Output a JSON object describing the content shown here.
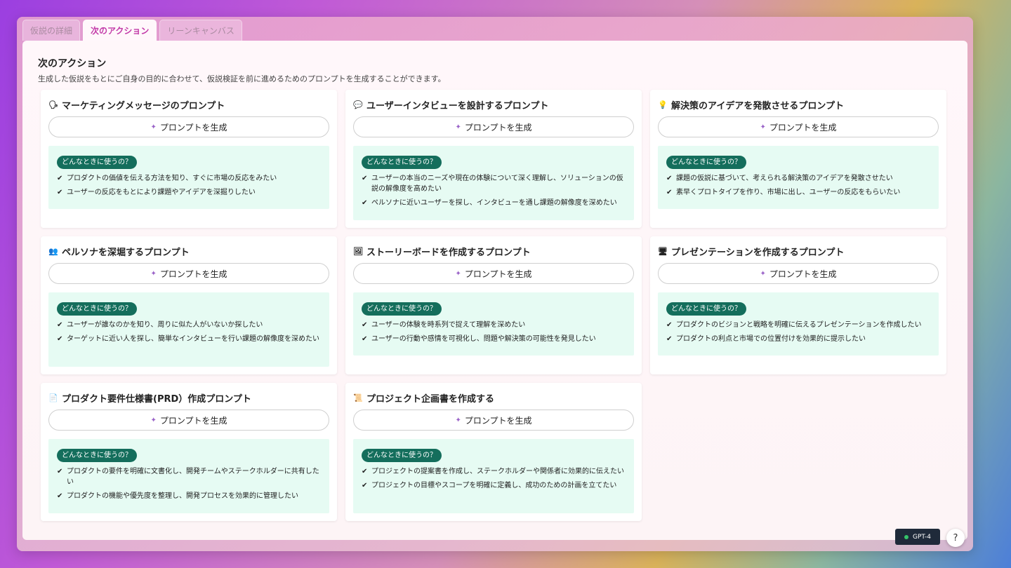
{
  "tabs": [
    {
      "label": "仮説の詳細",
      "active": false
    },
    {
      "label": "次のアクション",
      "active": true
    },
    {
      "label": "リーンキャンバス",
      "active": false
    }
  ],
  "section": {
    "title": "次のアクション",
    "description": "生成した仮説をもとにご自身の目的に合わせて、仮説検証を前に進めるためのプロンプトを生成することができます。"
  },
  "generate_label": "プロンプトを生成",
  "usage_badge": "どんなときに使うの？",
  "cards": [
    {
      "icon": "🗣",
      "title": "マーケティングメッセージのプロンプト",
      "uses": [
        "プロダクトの価値を伝える方法を知り、すぐに市場の反応をみたい",
        "ユーザーの反応をもとにより課題やアイデアを深掘りしたい"
      ]
    },
    {
      "icon": "💬",
      "title": "ユーザーインタビューを設計するプロンプト",
      "uses": [
        "ユーザーの本当のニーズや現在の体験について深く理解し、ソリューションの仮説の解像度を高めたい",
        "ペルソナに近いユーザーを探し、インタビューを通し課題の解像度を深めたい"
      ]
    },
    {
      "icon": "💡",
      "title": "解決策のアイデアを発散させるプロンプト",
      "uses": [
        "課題の仮説に基づいて、考えられる解決策のアイデアを発散させたい",
        "素早くプロトタイプを作り、市場に出し、ユーザーの反応をもらいたい"
      ]
    },
    {
      "icon": "👥",
      "title": "ペルソナを深堀するプロンプト",
      "uses": [
        "ユーザーが誰なのかを知り、周りに似た人がいないか探したい",
        "ターゲットに近い人を探し、簡単なインタビューを行い課題の解像度を深めたい"
      ]
    },
    {
      "icon": "🖼",
      "title": "ストーリーボードを作成するプロンプト",
      "uses": [
        "ユーザーの体験を時系列で捉えて理解を深めたい",
        "ユーザーの行動や感情を可視化し、問題や解決策の可能性を発見したい"
      ]
    },
    {
      "icon": "🖥",
      "title": "プレゼンテーションを作成するプロンプト",
      "uses": [
        "プロダクトのビジョンと戦略を明確に伝えるプレゼンテーションを作成したい",
        "プロダクトの利点と市場での位置付けを効果的に提示したい"
      ]
    },
    {
      "icon": "📄",
      "title": "プロダクト要件仕様書(PRD）作成プロンプト",
      "uses": [
        "プロダクトの要件を明確に文書化し、開発チームやステークホルダーに共有したい",
        "プロダクトの機能や優先度を整理し、開発プロセスを効果的に管理したい"
      ]
    },
    {
      "icon": "📜",
      "title": "プロジェクト企画書を作成する",
      "uses": [
        "プロジェクトの提案書を作成し、ステークホルダーや関係者に効果的に伝えたい",
        "プロジェクトの目標やスコープを明確に定義し、成功のための計画を立てたい"
      ]
    }
  ],
  "model": "GPT-4",
  "help": "?"
}
